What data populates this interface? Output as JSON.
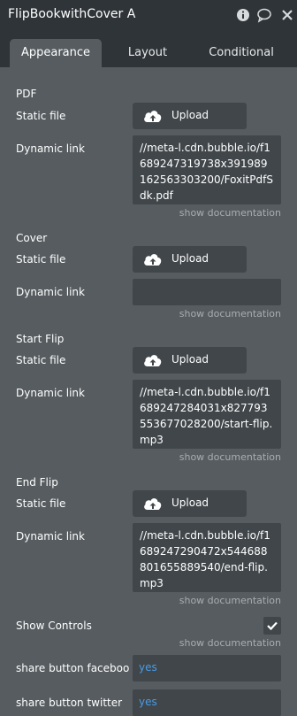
{
  "header": {
    "title": "FlipBookwithCover A"
  },
  "tabs": [
    {
      "label": "Appearance"
    },
    {
      "label": "Layout"
    },
    {
      "label": "Conditional"
    }
  ],
  "labels": {
    "static_file": "Static file",
    "dynamic_link": "Dynamic link",
    "upload": "Upload",
    "show_documentation": "show documentation"
  },
  "sections": {
    "pdf": {
      "title": "PDF",
      "dynamic_link": "//meta-l.cdn.bubble.io/f1689247319738x391989162563303200/FoxitPdfSdk.pdf"
    },
    "cover": {
      "title": "Cover",
      "dynamic_link": ""
    },
    "start_flip": {
      "title": "Start Flip",
      "dynamic_link": "//meta-l.cdn.bubble.io/f1689247284031x827793553677028200/start-flip.mp3"
    },
    "end_flip": {
      "title": "End Flip",
      "dynamic_link": "//meta-l.cdn.bubble.io/f1689247290472x544688801655889540/end-flip.mp3"
    }
  },
  "show_controls": {
    "label": "Show Controls",
    "checked": true
  },
  "share_facebook": {
    "label": "share button faceboo",
    "value": "yes"
  },
  "share_twitter": {
    "label": "share button twitter",
    "value": "yes"
  },
  "colors": {
    "panel": "#565c60",
    "header": "#2f3438",
    "field": "#40464a",
    "link": "#4a9be7"
  }
}
